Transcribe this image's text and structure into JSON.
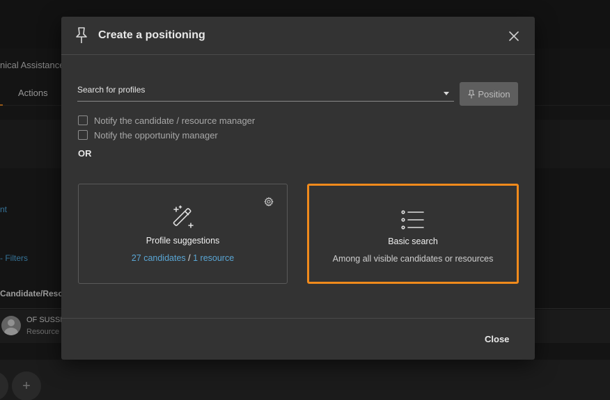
{
  "background": {
    "page_title": "nical Assistance",
    "tab_actions": "Actions",
    "link_partial": "nt",
    "filters_link": "- Filters",
    "column_header": "Candidate/Resou",
    "row": {
      "name": "OF SUSSI",
      "sub": "Resource"
    },
    "fab_add": "+"
  },
  "modal": {
    "title": "Create a positioning",
    "search": {
      "label": "Search for profiles"
    },
    "position_button": "Position",
    "checkboxes": [
      {
        "label": "Notify the candidate / resource manager",
        "checked": false
      },
      {
        "label": "Notify the opportunity manager",
        "checked": false
      }
    ],
    "or_label": "OR",
    "cards": {
      "suggestions": {
        "title": "Profile suggestions",
        "candidates_link": "27 candidates",
        "separator": "/",
        "resources_link": "1 resource",
        "icon": "magic-wand-icon"
      },
      "basic_search": {
        "title": "Basic search",
        "subtitle": "Among all visible candidates or resources",
        "icon": "list-icon"
      }
    },
    "close_button": "Close"
  },
  "colors": {
    "accent_highlight": "#f08a1c",
    "link": "#5aa7d6",
    "modal_bg": "#333333"
  }
}
